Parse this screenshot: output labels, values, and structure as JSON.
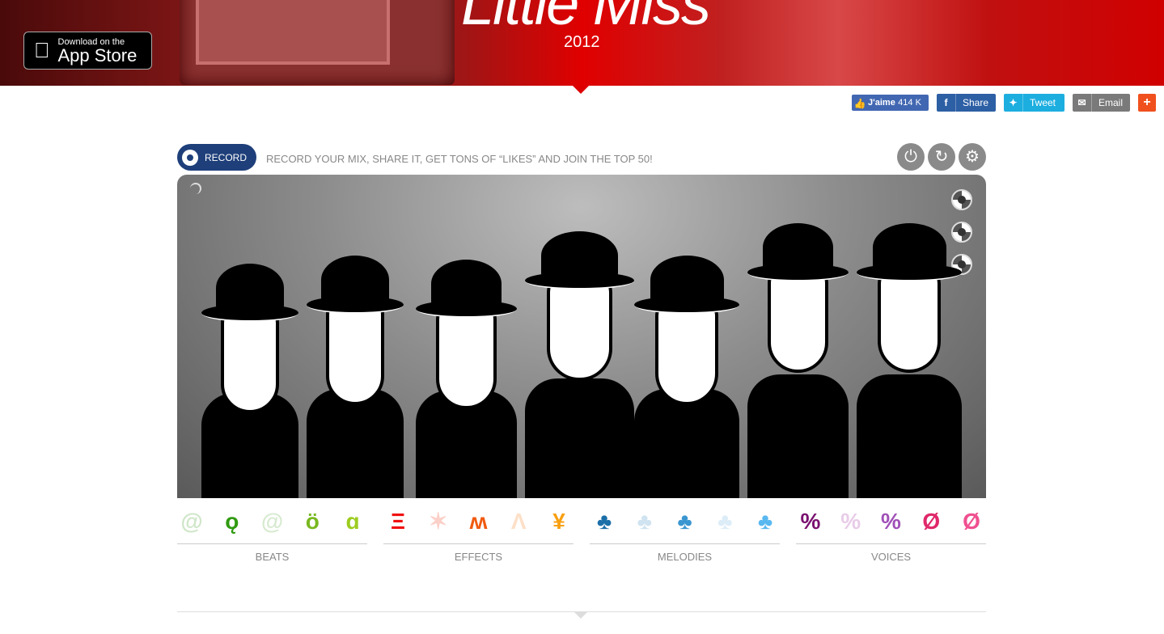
{
  "banner": {
    "title": "Little Miss",
    "year": "2012",
    "appstore": {
      "line1": "Download on the",
      "line2": "App Store"
    }
  },
  "social": {
    "like": {
      "label": "J'aime",
      "count": "414 K",
      "color": "#4267b2"
    },
    "share": {
      "label": "Share",
      "color": "#2d5fa5"
    },
    "tweet": {
      "label": "Tweet",
      "color": "#1daee0"
    },
    "email": {
      "label": "Email",
      "color": "#7a7a7a"
    },
    "more": {
      "label": "+",
      "color": "#f0501e"
    }
  },
  "toolbar": {
    "record_label": "RECORD",
    "tagline": "RECORD YOUR MIX, SHARE IT, GET TONS OF “LIKES” AND JOIN THE TOP 50!",
    "controls": [
      "power-icon",
      "refresh-icon",
      "gear-icon"
    ]
  },
  "groups": [
    {
      "label": "BEATS",
      "colors": [
        "#cfe6c8",
        "#2f9a10",
        "#d7ead0",
        "#79b820",
        "#9ccc20"
      ],
      "glyphs": [
        "@",
        "ǫ",
        "@",
        "ö",
        "ɑ"
      ]
    },
    {
      "label": "EFFECTS",
      "colors": [
        "#f01010",
        "#fbd0c8",
        "#f05a10",
        "#fde0c8",
        "#f8a010"
      ],
      "glyphs": [
        "Ξ",
        "✶",
        "ʍ",
        "Ʌ",
        "¥"
      ]
    },
    {
      "label": "MELODIES",
      "colors": [
        "#1a6fa8",
        "#cfe3f0",
        "#3a96d0",
        "#dcedf8",
        "#5ab8f0"
      ],
      "glyphs": [
        "♣",
        "♣",
        "♣",
        "♣",
        "♣"
      ]
    },
    {
      "label": "VOICES",
      "colors": [
        "#7a1070",
        "#e8cce8",
        "#a050b8",
        "#e0286a",
        "#f05090"
      ],
      "glyphs": [
        "%",
        "%",
        "%",
        "Ø",
        "Ø"
      ]
    }
  ]
}
